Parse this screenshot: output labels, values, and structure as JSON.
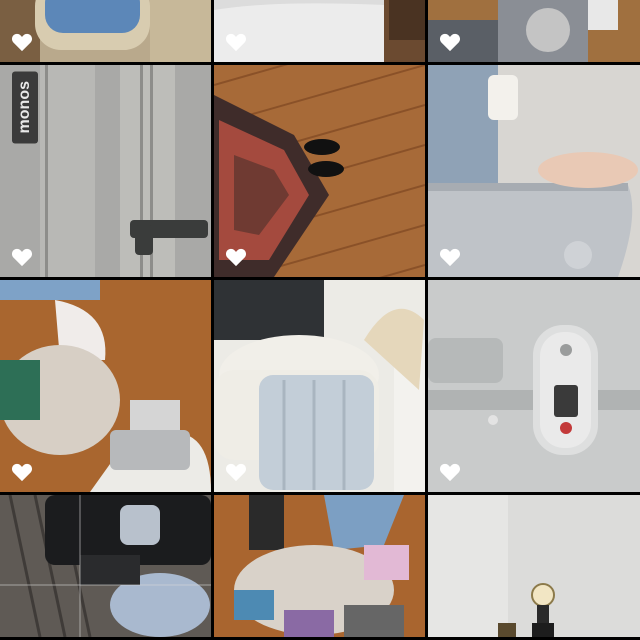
{
  "grid": {
    "brand_text": "monos",
    "tiles": [
      {
        "scene": "airplane-window",
        "liked": true
      },
      {
        "scene": "bed",
        "liked": true
      },
      {
        "scene": "clothes-floor-top",
        "liked": true
      },
      {
        "scene": "bag-strap",
        "liked": true
      },
      {
        "scene": "rug-shoes",
        "liked": true
      },
      {
        "scene": "hand-suitcase",
        "liked": true
      },
      {
        "scene": "woman-clothes-floor",
        "liked": true
      },
      {
        "scene": "suitcase-chair",
        "liked": true
      },
      {
        "scene": "tsa-lock",
        "liked": true
      },
      {
        "scene": "backpack-deck",
        "liked": false
      },
      {
        "scene": "clothes-floor-bottom",
        "liked": false
      },
      {
        "scene": "lamp-wall",
        "liked": false
      }
    ]
  },
  "icons": {
    "like": "heart-icon"
  },
  "colors": {
    "heart": "#ffffff",
    "background": "#000000"
  }
}
